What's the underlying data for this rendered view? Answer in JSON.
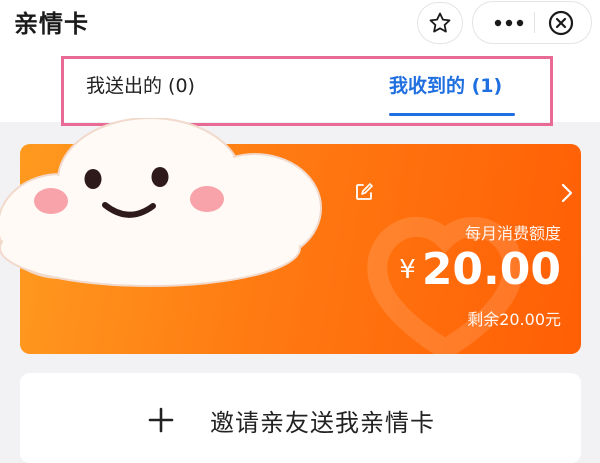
{
  "header": {
    "title": "亲情卡"
  },
  "tabs": [
    {
      "label": "我送出的 (0)",
      "active": false
    },
    {
      "label": "我收到的 (1)",
      "active": true
    }
  ],
  "card": {
    "limit_label": "每月消费额度",
    "currency": "¥",
    "amount": "20.00",
    "remaining": "剩余20.00元"
  },
  "invite": {
    "label": "邀请亲友送我亲情卡"
  },
  "colors": {
    "accent_blue": "#1f6fe0",
    "card_orange": "#ff7a12",
    "highlight_pink": "#e86b96"
  },
  "icons": [
    "star-icon",
    "more-icon",
    "close-icon",
    "edit-icon",
    "chevron-right-icon",
    "plus-icon",
    "cloud-sticker"
  ]
}
